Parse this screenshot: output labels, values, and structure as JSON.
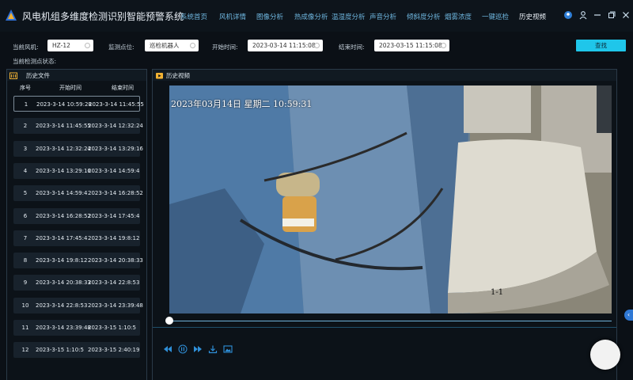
{
  "app": {
    "title": "风电机组多维度检测识别智能预警系统"
  },
  "nav": [
    {
      "label": "系统首页"
    },
    {
      "label": "风机详情"
    },
    {
      "label": "图像分析"
    },
    {
      "label": "热成像分析"
    },
    {
      "label": "温湿度分析"
    },
    {
      "label": "声音分析"
    },
    {
      "label": "倾斜度分析"
    },
    {
      "label": "烟雾浓度"
    },
    {
      "label": "一键巡检"
    },
    {
      "label": "历史视频",
      "active": true
    }
  ],
  "header_icons": [
    "location-icon",
    "user-icon",
    "minimize-icon",
    "restore-icon",
    "close-icon"
  ],
  "filters": {
    "turbine": {
      "label": "当前风机:",
      "value": "HZ-12"
    },
    "point": {
      "label": "监测点位:",
      "value": "巡检机器人"
    },
    "start": {
      "label": "开始时间:",
      "value": "2023-03-14 11:15:08"
    },
    "end": {
      "label": "结束时间:",
      "value": "2023-03-15 11:15:08"
    },
    "search_label": "查找",
    "status_label": "当前检测点状态:"
  },
  "history": {
    "title": "历史文件",
    "columns": {
      "no": "序号",
      "start": "开始时间",
      "end": "结束时间"
    },
    "rows": [
      {
        "no": "1",
        "start": "2023-3-14 10:59:28",
        "end": "2023-3-14 11:45:55"
      },
      {
        "no": "2",
        "start": "2023-3-14 11:45:55",
        "end": "2023-3-14 12:32:24"
      },
      {
        "no": "3",
        "start": "2023-3-14 12:32:24",
        "end": "2023-3-14 13:29:16"
      },
      {
        "no": "4",
        "start": "2023-3-14 13:29:16",
        "end": "2023-3-14 14:59:4"
      },
      {
        "no": "5",
        "start": "2023-3-14 14:59:4",
        "end": "2023-3-14 16:28:52"
      },
      {
        "no": "6",
        "start": "2023-3-14 16:28:52",
        "end": "2023-3-14 17:45:4"
      },
      {
        "no": "7",
        "start": "2023-3-14 17:45:4",
        "end": "2023-3-14 19:8:12"
      },
      {
        "no": "8",
        "start": "2023-3-14 19:8:12",
        "end": "2023-3-14 20:38:33"
      },
      {
        "no": "9",
        "start": "2023-3-14 20:38:33",
        "end": "2023-3-14 22:8:53"
      },
      {
        "no": "10",
        "start": "2023-3-14 22:8:53",
        "end": "2023-3-14 23:39:48"
      },
      {
        "no": "11",
        "start": "2023-3-14 23:39:48",
        "end": "2023-3-15 1:10:5"
      },
      {
        "no": "12",
        "start": "2023-3-15 1:10:5",
        "end": "2023-3-15 2:40:19"
      }
    ]
  },
  "video": {
    "title": "历史视频",
    "overlay_date": "2023年03月14日  星期二  10:59:31",
    "overlay_cam": "1-1",
    "progress": 0.0,
    "controls": [
      "rewind-icon",
      "pause-icon",
      "fast-forward-icon",
      "download-icon",
      "screenshot-icon"
    ]
  },
  "colors": {
    "accent": "#1fc6ea",
    "nav_text": "#6fb7e0",
    "background": "#0b1016"
  }
}
